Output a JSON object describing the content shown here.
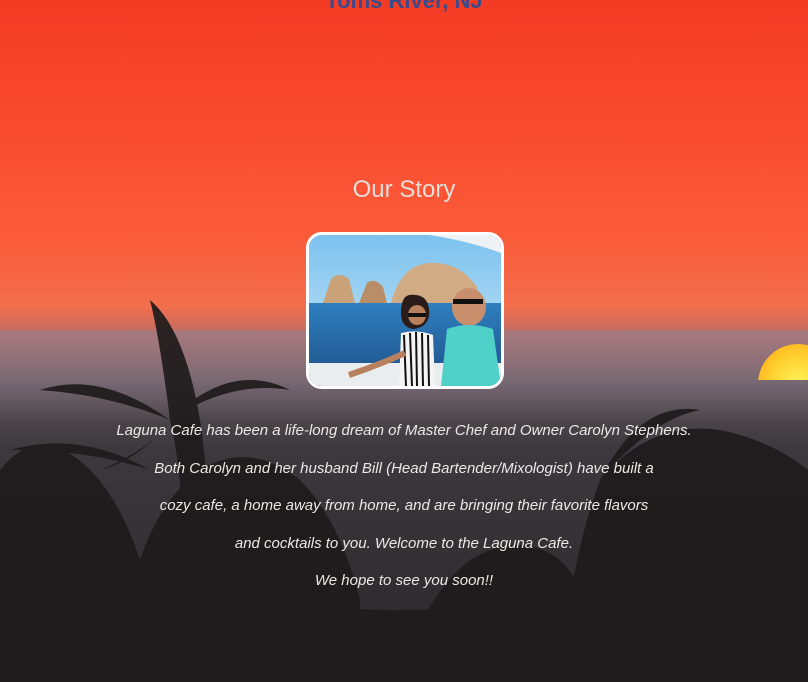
{
  "header": {
    "location": "Toms River, NJ"
  },
  "story": {
    "title": "Our Story",
    "lines": [
      "Laguna Cafe has been a life-long dream of Master Chef and Owner Carolyn Stephens.",
      "Both Carolyn and her husband Bill (Head Bartender/Mixologist) have built a",
      "cozy cafe, a home away from home, and are bringing their favorite flavors",
      "and cocktails to you. Welcome to the Laguna Cafe.",
      "We hope to see you soon!!"
    ]
  },
  "colors": {
    "title_text": "#3a4a8a",
    "section_title": "#e4ded9",
    "body_text": "#ece8e4",
    "sunset_top": "#f33b24"
  }
}
